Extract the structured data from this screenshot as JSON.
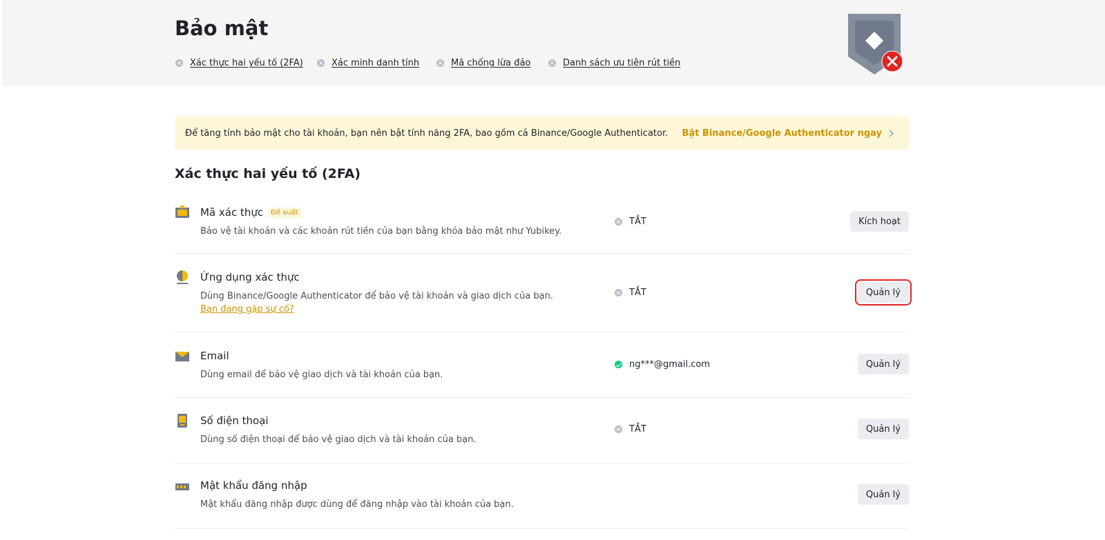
{
  "header": {
    "title": "Bảo mật",
    "checklist": [
      {
        "label": "Xác thực hai yếu tố (2FA)"
      },
      {
        "label": "Xác minh danh tính"
      },
      {
        "label": "Mã chống lừa đảo"
      },
      {
        "label": "Danh sách ưu tiên rút tiền"
      }
    ]
  },
  "banner": {
    "text": "Để tăng tính bảo mật cho tài khoản, bạn nên bật tính năng 2FA, bao gồm cả Binance/Google Authenticator.",
    "link": "Bật Binance/Google Authenticator ngay"
  },
  "section": {
    "title": "Xác thực hai yếu tố (2FA)",
    "rows": [
      {
        "title": "Mã xác thực",
        "badge": "Đề xuất",
        "desc": "Bảo vệ tài khoản và các khoản rút tiền của bạn bằng khóa bảo mật như Yubikey.",
        "status": "TẮT",
        "button": "Kích hoạt",
        "icon": "security-key-icon"
      },
      {
        "title": "Ứng dụng xác thực",
        "desc": "Dùng Binance/Google Authenticator để bảo vệ tài khoản và giao dịch của bạn.",
        "help": "Bạn đang gặp sự cố?",
        "status": "TẮT",
        "button": "Quản lý",
        "icon": "authenticator-icon"
      },
      {
        "title": "Email",
        "desc": "Dùng email để bảo vệ giao dịch và tài khoản của bạn.",
        "status": "ng***@gmail.com",
        "button": "Quản lý",
        "icon": "mail-icon"
      },
      {
        "title": "Số điện thoại",
        "desc": "Dùng số điện thoại để bảo vệ giao dịch và tài khoản của bạn.",
        "status": "TẮT",
        "button": "Quản lý",
        "icon": "phone-icon"
      },
      {
        "title": "Mật khẩu đăng nhập",
        "desc": "Mật khẩu đăng nhập được dùng để đăng nhập vào tài khoản của bạn.",
        "button": "Quản lý",
        "icon": "password-icon"
      }
    ]
  },
  "colors": {
    "accent": "#c99400",
    "banner_bg": "#fef6d8",
    "status_off": "#b7bdc6",
    "status_on": "#0ecb81",
    "error_red": "#e02424"
  }
}
